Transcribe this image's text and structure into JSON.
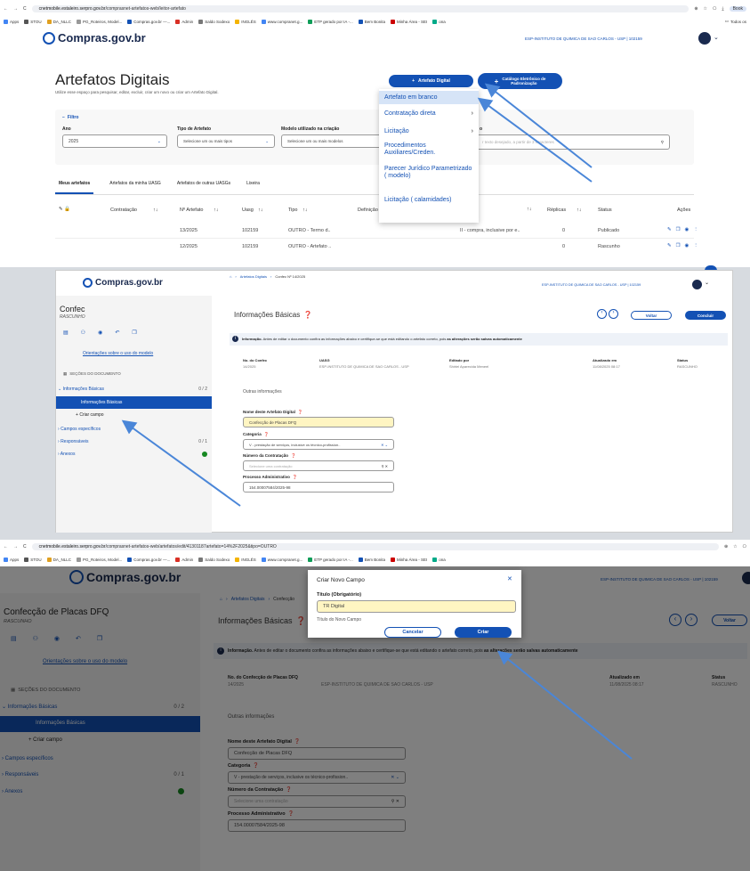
{
  "browser": {
    "url_domain": "cnetmobile.estaleiro.serpro.gov.br",
    "url_path_1": "/comprasnet-artefatos-web/leitor-artefato",
    "url_path_2": "/comprasnet-artefatos-web/artefatos/edit/41301187artefato=14%2F2025&tipo=OUTRO",
    "bookmarks": [
      "Apps",
      "STOU",
      "DA_NLLC",
      "PG_Roteiros, Model...",
      "Compras.gov.br —...",
      "Admin",
      "Saldo Sodexo",
      "INGLÊS",
      "www.compranet.g...",
      "ETP gerado por IA -...",
      "Bem Bonita",
      "Minha Área - SEI",
      "ona"
    ],
    "right_bookmarks": "Todos os",
    "right_profile": "Book"
  },
  "logo": {
    "text": "Compras.gov.br"
  },
  "user_unit": "ESP-INSTITUTO DE QUIMICA DE SAO CARLOS - USP | 102159",
  "panel1": {
    "title": "Artefatos Digitais",
    "subtitle": "Utilize esse espaço para pesquisar, editar, excluir, criar um novo ou criar um Artefato Digital.",
    "btn_new": "Artefato Digital",
    "btn_catalog_1": "Catálogo Eletrônico de",
    "btn_catalog_2": "Padronização",
    "filter": "Filtro",
    "year_label": "Ano",
    "year_value": "2025",
    "type_label": "Tipo de Artefato",
    "type_placeholder": "Selecione um ou mais tipos",
    "model_label": "Modelo utilizado na criação",
    "model_placeholder": "Selecione um ou mais modelos",
    "search_label": "o",
    "search_placeholder": "r texto desejado, a partir de 3 caracteres",
    "tabs": [
      "Meus artefatos",
      "Artefatos da minha UASG",
      "Artefatos de outras UASGs",
      "Lixeira"
    ],
    "columns": [
      "Contratação",
      "Nº Artefato",
      "Uasg",
      "Tipo",
      "Definição c",
      "a /",
      "goria",
      "Réplicas",
      "Status",
      "Ações"
    ],
    "rows": [
      {
        "num": "13/2025",
        "uasg": "102159",
        "tipo": "OUTRO - Termo d..",
        "cat": "II - compra, inclusive por e..",
        "rep": "0",
        "status": "Publicado"
      },
      {
        "num": "12/2025",
        "uasg": "102159",
        "tipo": "OUTRO - Artefato ..",
        "cat": "",
        "rep": "0",
        "status": "Rascunho"
      }
    ],
    "menu": [
      "Artefato em branco",
      "Contratação direta",
      "Licitação",
      "Procedimentos Auxiliares/Creden.",
      "Parecer Jurídico Parametrizado ( modelo)",
      "Licitação ( calamidades)"
    ]
  },
  "panel2": {
    "doc_title": "Confec",
    "doc_status": "RASCUNHO",
    "guide_link": "Orientações sobre o uso do modelo",
    "sections_header": "SEÇÕES DO DOCUMENTO",
    "nav": [
      {
        "label": "Informações Básicas",
        "count": "0 / 2"
      },
      {
        "label": "Informações Básicas",
        "count": ""
      },
      {
        "label": "Criar campo",
        "count": ""
      },
      {
        "label": "Campos específicos",
        "count": ""
      },
      {
        "label": "Responsáveis",
        "count": "0 / 1"
      },
      {
        "label": "Anexos",
        "count": ""
      }
    ],
    "breadcrumb_1": "Artefatos Digitais",
    "breadcrumb_2": "Confec Nº 14/2025",
    "section_title": "Informações Básicas",
    "btn_back": "Voltar",
    "btn_finish": "Concluir",
    "info_bold": "Informação.",
    "info_text": "Antes de editar o documento confira as informações abaixo e certifique-se que está editando o artefato correto, pois",
    "info_bold2": "as alterações serão salvas automaticamente",
    "meta_labels": [
      "No. do Confec",
      "UASG",
      "Editado por",
      "Atualizado em",
      "Status"
    ],
    "meta_values": [
      "14/2025",
      "ESP-INSTITUTO DE QUIMICA DE SAO CARLOS - USP",
      "Shirlei Aparecida Meneel",
      "11/08/2025 08:17",
      "RASCUNHO"
    ],
    "other_info": "Outras informações",
    "name_label": "Nome deste Artefato Digital",
    "name_value": "Confecção de Placas DFQ",
    "cat_label": "Categoria",
    "cat_value": "V - prestação de serviços, inclusive os técnico-profission..",
    "contract_label": "Número da Contratação",
    "contract_placeholder": "Selecione uma contratação",
    "process_label": "Processo Administrativo",
    "process_value": "154.00007584/2025-98"
  },
  "panel3": {
    "doc_title": "Confecção de Placas DFQ",
    "breadcrumb_2": "Confecção",
    "meta_label_1": "No. do Confecção de Placas DFQ",
    "name_value": "Confecção de Placas DFQ",
    "dialog": {
      "title": "Criar Novo Campo",
      "field_label": "Título (Obrigatório)",
      "field_value": "TR Digital",
      "helper": "Título do Novo Campo",
      "cancel": "Cancelar",
      "create": "Criar"
    },
    "info_bold2": "as alterações serão salvas automaticamente",
    "info_text_tail": "rreto, pois"
  },
  "colors": {
    "primary": "#1351b4",
    "green": "#168821",
    "highlight_field": "#fff5c2"
  }
}
